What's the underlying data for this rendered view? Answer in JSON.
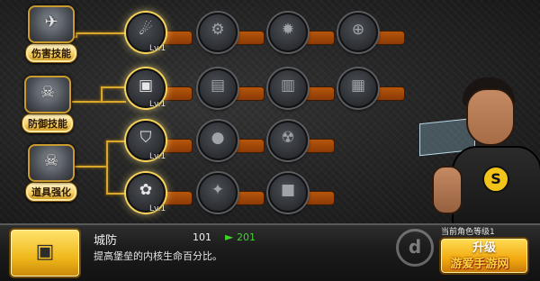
{
  "categories": [
    {
      "label": "伤害技能",
      "icon": "rocket-launcher-icon",
      "glyph": "✈"
    },
    {
      "label": "防御技能",
      "icon": "skull-shield-icon",
      "glyph": "☠"
    },
    {
      "label": "道具强化",
      "icon": "skull-banner-icon",
      "glyph": "☠"
    }
  ],
  "rows": [
    {
      "nodes": [
        {
          "icon": "fire-orb-icon",
          "glyph": "☄",
          "level": "Lv.1",
          "unlocked": true
        },
        {
          "icon": "cannon-icon",
          "glyph": "⚙",
          "level": "",
          "unlocked": false
        },
        {
          "icon": "mine-icon",
          "glyph": "✹",
          "level": "",
          "unlocked": false
        },
        {
          "icon": "satellite-icon",
          "glyph": "⊕",
          "level": "",
          "unlocked": false
        }
      ]
    },
    {
      "nodes": [
        {
          "icon": "fortress-icon",
          "glyph": "▣",
          "level": "Lv.1",
          "unlocked": true
        },
        {
          "icon": "bunker-icon",
          "glyph": "▤",
          "level": "",
          "unlocked": false
        },
        {
          "icon": "barrier-icon",
          "glyph": "▥",
          "level": "",
          "unlocked": false
        },
        {
          "icon": "armor-wall-icon",
          "glyph": "▦",
          "level": "",
          "unlocked": false
        }
      ]
    },
    {
      "nodes": [
        {
          "icon": "container-icon",
          "glyph": "⛉",
          "level": "Lv.1",
          "unlocked": true
        },
        {
          "icon": "grenade-icon",
          "glyph": "●",
          "level": "",
          "unlocked": false
        },
        {
          "icon": "radiation-icon",
          "glyph": "☢",
          "level": "",
          "unlocked": false
        }
      ]
    },
    {
      "nodes": [
        {
          "icon": "monster-plant-icon",
          "glyph": "✿",
          "level": "Lv.1",
          "unlocked": true
        },
        {
          "icon": "bomb-icon",
          "glyph": "✦",
          "level": "",
          "unlocked": false
        },
        {
          "icon": "crate-icon",
          "glyph": "■",
          "level": "",
          "unlocked": false
        }
      ]
    }
  ],
  "selected": {
    "name": "城防",
    "description": "提高堡垒的内核生命百分比。",
    "current_value": "101",
    "next_value": "201",
    "thumbnail_icon": "fortress-icon",
    "thumbnail_glyph": "▣"
  },
  "upgrade": {
    "top_label": "当前角色等级1",
    "button_label": "升级"
  },
  "watermark": {
    "text": "游爱手游网",
    "logo_letter": "d"
  },
  "hero_logo": "S",
  "colors": {
    "gold": "#f2cf63",
    "progress_bar": "#b5560c",
    "next_value": "#3fd42a",
    "upgrade_button": "#f2a90e"
  }
}
